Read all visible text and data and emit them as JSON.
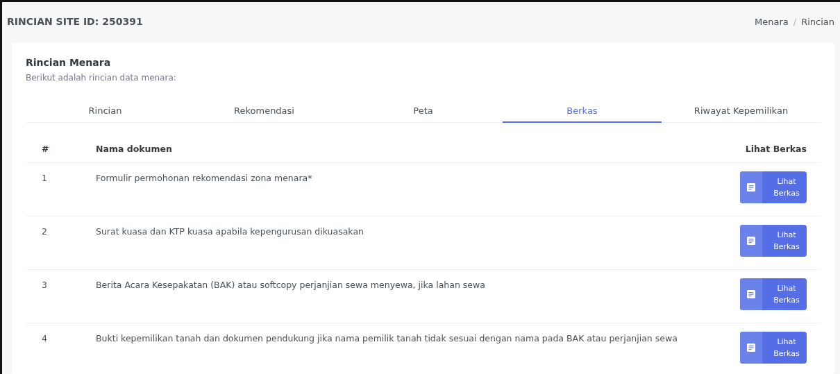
{
  "page_title": "RINCIAN SITE ID: **250391**",
  "breadcrumb": {
    "items": [
      {
        "label": "Menara"
      },
      {
        "label": "Rincian"
      }
    ],
    "separator": "/"
  },
  "card": {
    "title": "Rincian Menara",
    "subtitle": "Berikut adalah rincian data menara:"
  },
  "tabs": [
    {
      "label": "Rincian",
      "selected": false
    },
    {
      "label": "Rekomendasi",
      "selected": false
    },
    {
      "label": "Peta",
      "selected": false
    },
    {
      "label": "Berkas",
      "selected": true
    },
    {
      "label": "Riwayat Kepemilikan",
      "selected": false
    }
  ],
  "table": {
    "columns": [
      "#",
      "Nama dokumen",
      "Lihat Berkas"
    ],
    "rows": [
      {
        "no": "1",
        "name": "Formulir permohonan rekomendasi zona menara*",
        "button": "Lihat Berkas"
      },
      {
        "no": "2",
        "name": "Surat kuasa dan KTP kuasa apabila kepengurusan dikuasakan",
        "button": "Lihat Berkas"
      },
      {
        "no": "3",
        "name": "Berita Acara Kesepakatan (BAK) atau softcopy perjanjian sewa menyewa, jika lahan sewa",
        "button": "Lihat Berkas"
      },
      {
        "no": "4",
        "name": "Bukti kepemilikan tanah dan dokumen pendukung jika nama pemilik tanah tidak sesuai dengan nama pada BAK atau perjanjian sewa",
        "button": "Lihat Berkas"
      }
    ]
  }
}
